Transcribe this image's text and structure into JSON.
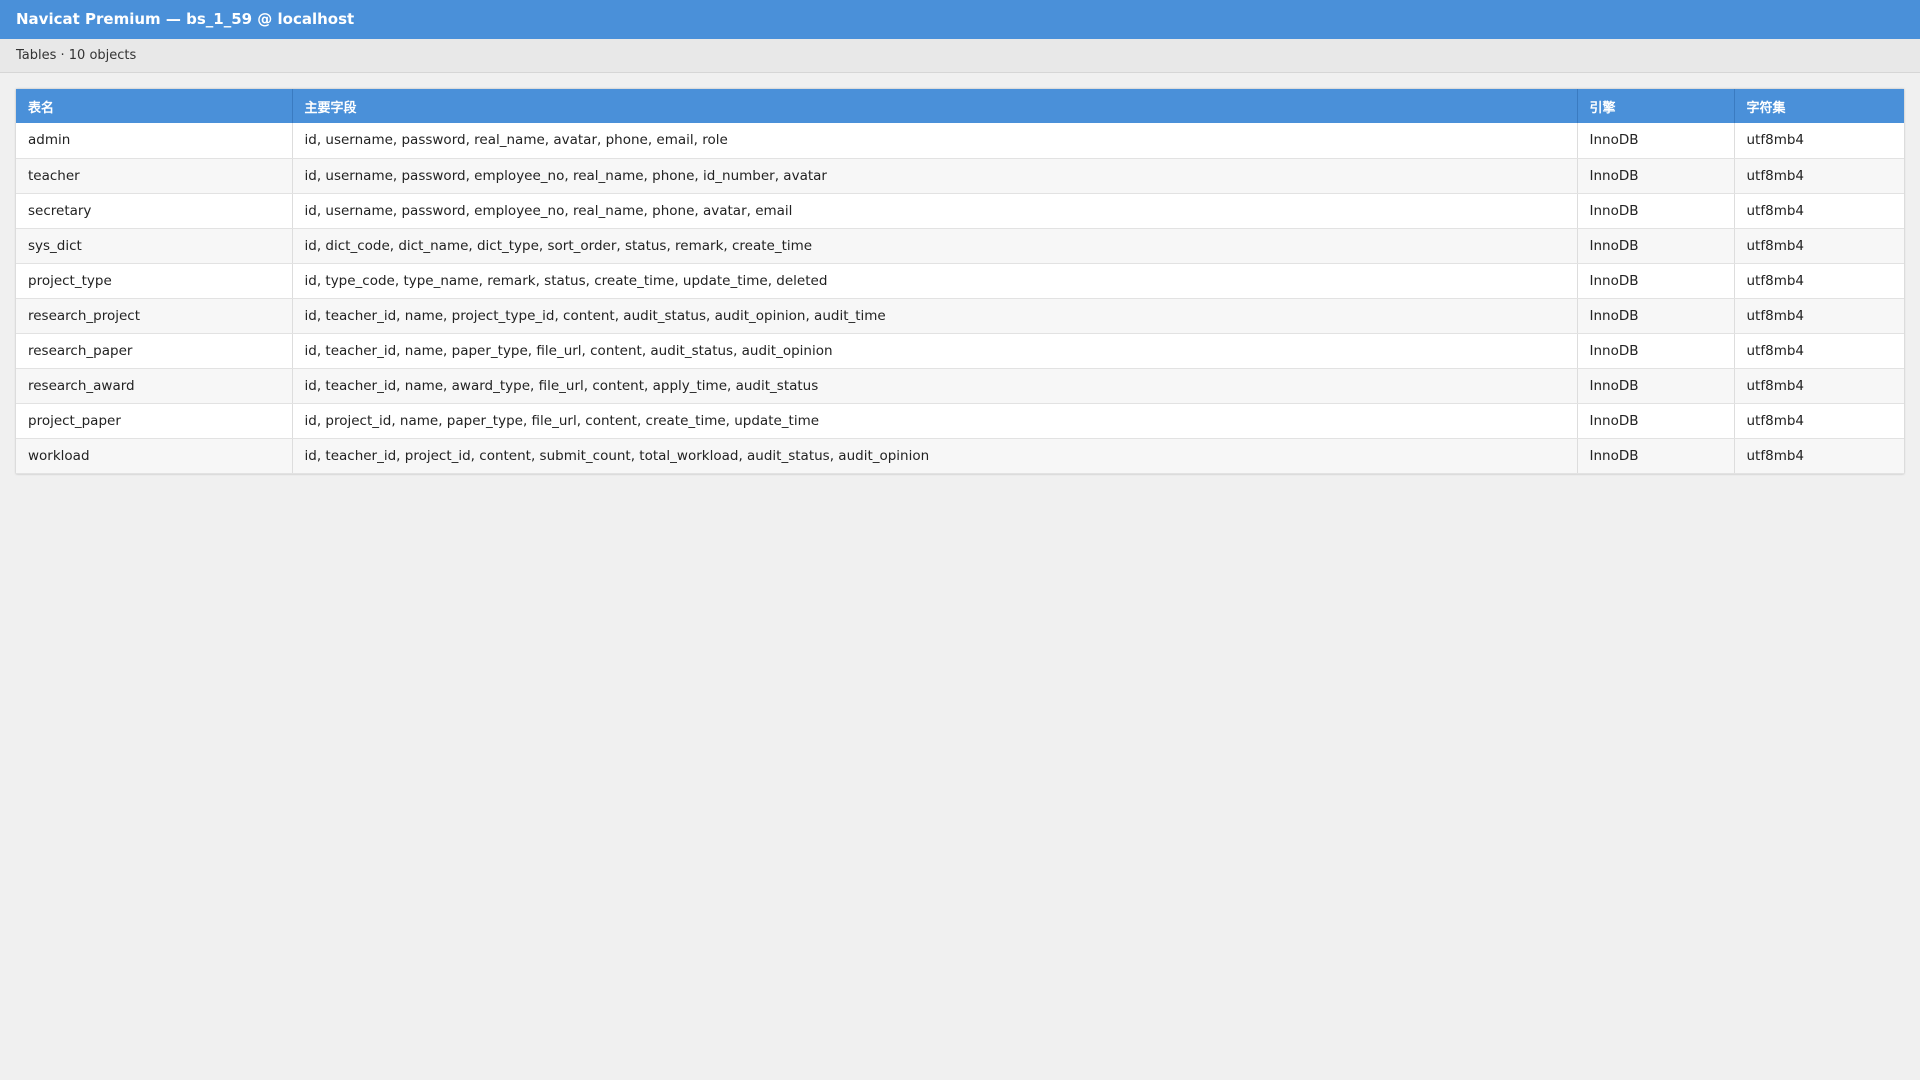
{
  "window": {
    "title": "Navicat Premium — bs_1_59 @ localhost"
  },
  "toolbar": {
    "summary": "Tables · 10 objects"
  },
  "table": {
    "columns": [
      "表名",
      "主要字段",
      "引擎",
      "字符集"
    ],
    "rows": [
      {
        "name": "admin",
        "fields": "id, username, password, real_name, avatar, phone, email, role",
        "engine": "InnoDB",
        "charset": "utf8mb4"
      },
      {
        "name": "teacher",
        "fields": "id, username, password, employee_no, real_name, phone, id_number, avatar",
        "engine": "InnoDB",
        "charset": "utf8mb4"
      },
      {
        "name": "secretary",
        "fields": "id, username, password, employee_no, real_name, phone, avatar, email",
        "engine": "InnoDB",
        "charset": "utf8mb4"
      },
      {
        "name": "sys_dict",
        "fields": "id, dict_code, dict_name, dict_type, sort_order, status, remark, create_time",
        "engine": "InnoDB",
        "charset": "utf8mb4"
      },
      {
        "name": "project_type",
        "fields": "id, type_code, type_name, remark, status, create_time, update_time, deleted",
        "engine": "InnoDB",
        "charset": "utf8mb4"
      },
      {
        "name": "research_project",
        "fields": "id, teacher_id, name, project_type_id, content, audit_status, audit_opinion, audit_time",
        "engine": "InnoDB",
        "charset": "utf8mb4"
      },
      {
        "name": "research_paper",
        "fields": "id, teacher_id, name, paper_type, file_url, content, audit_status, audit_opinion",
        "engine": "InnoDB",
        "charset": "utf8mb4"
      },
      {
        "name": "research_award",
        "fields": "id, teacher_id, name, award_type, file_url, content, apply_time, audit_status",
        "engine": "InnoDB",
        "charset": "utf8mb4"
      },
      {
        "name": "project_paper",
        "fields": "id, project_id, name, paper_type, file_url, content, create_time, update_time",
        "engine": "InnoDB",
        "charset": "utf8mb4"
      },
      {
        "name": "workload",
        "fields": "id, teacher_id, project_id, content, submit_count, total_workload, audit_status, audit_opinion",
        "engine": "InnoDB",
        "charset": "utf8mb4"
      }
    ]
  },
  "colors": {
    "accent": "#4a90d9",
    "background": "#f0f0f0",
    "toolbar": "#e8e8e8"
  }
}
